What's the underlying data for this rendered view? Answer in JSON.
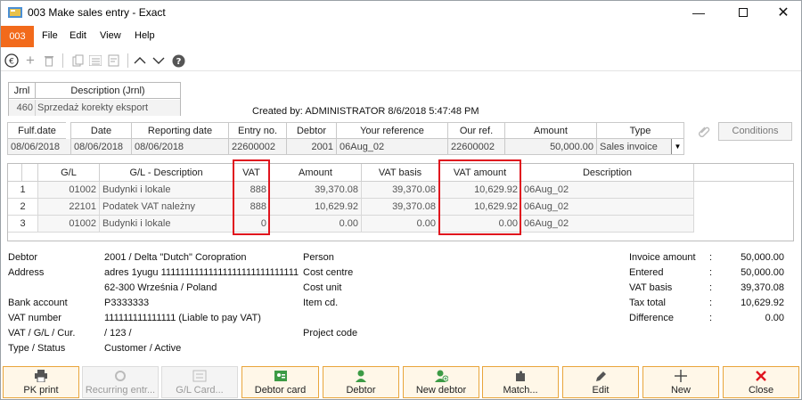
{
  "window": {
    "title": "003 Make sales entry - Exact"
  },
  "menu": {
    "badge": "003",
    "items": [
      "File",
      "Edit",
      "View",
      "Help"
    ]
  },
  "journal": {
    "headers": [
      "Jrnl",
      "Description (Jrnl)"
    ],
    "code": "460",
    "description": "Sprzedaż korekty eksport"
  },
  "created_by": "Created by: ADMINISTRATOR  8/6/2018 5:47:48 PM",
  "entry": {
    "headers": [
      "Fulf.date",
      "Date",
      "Reporting date",
      "Entry no.",
      "Debtor",
      "Your reference",
      "Our ref.",
      "Amount",
      "Type"
    ],
    "values": [
      "08/06/2018",
      "08/06/2018",
      "08/06/2018",
      "22600002",
      "2001",
      "06Aug_02",
      "22600002",
      "50,000.00",
      "Sales invoice"
    ]
  },
  "conditions_button": "Conditions",
  "lines": {
    "headers": [
      "G/L",
      "G/L - Description",
      "VAT",
      "Amount",
      "VAT basis",
      "VAT amount",
      "Description"
    ],
    "rows": [
      {
        "n": "1",
        "gl": "01002",
        "desc": "Budynki i lokale",
        "vat": "888",
        "amount": "39,370.08",
        "vat_basis": "39,370.08",
        "vat_amount": "10,629.92",
        "description": "06Aug_02"
      },
      {
        "n": "2",
        "gl": "22101",
        "desc": "Podatek VAT należny",
        "vat": "888",
        "amount": "10,629.92",
        "vat_basis": "39,370.08",
        "vat_amount": "10,629.92",
        "description": "06Aug_02"
      },
      {
        "n": "3",
        "gl": "01002",
        "desc": "Budynki i lokale",
        "vat": "0",
        "amount": "0.00",
        "vat_basis": "0.00",
        "vat_amount": "0.00",
        "description": "06Aug_02"
      }
    ]
  },
  "details": {
    "left_labels": [
      "Debtor",
      "Address",
      "Bank account",
      "VAT number",
      "VAT / G/L / Cur.",
      "Type / Status"
    ],
    "debtor": "2001 / Delta \"Dutch\" Coropration",
    "address1": "adres 1yugu 1111111111111111111111111111111",
    "address2": "62-300 Września / Poland",
    "bank_account": "P3333333",
    "vat_number": "111111111111111 (Liable to pay VAT)",
    "vat_gl_cur": "/ 123 /",
    "type_status": "Customer / Active",
    "mid_labels": [
      "Person",
      "Cost centre",
      "Cost unit",
      "Item cd.",
      "Project code"
    ]
  },
  "totals": {
    "labels": [
      "Invoice amount",
      "Entered",
      "VAT basis",
      "Tax total",
      "Difference"
    ],
    "values": [
      "50,000.00",
      "50,000.00",
      "39,370.08",
      "10,629.92",
      "0.00"
    ],
    "sep": ":"
  },
  "buttons": [
    "PK print",
    "Recurring entr...",
    "G/L Card...",
    "Debtor card",
    "Debtor",
    "New debtor",
    "Match...",
    "Edit",
    "New",
    "Close"
  ],
  "colors": {
    "accent": "#f26a1b",
    "highlight": "#e0141e",
    "button_border": "#e9a53b"
  }
}
